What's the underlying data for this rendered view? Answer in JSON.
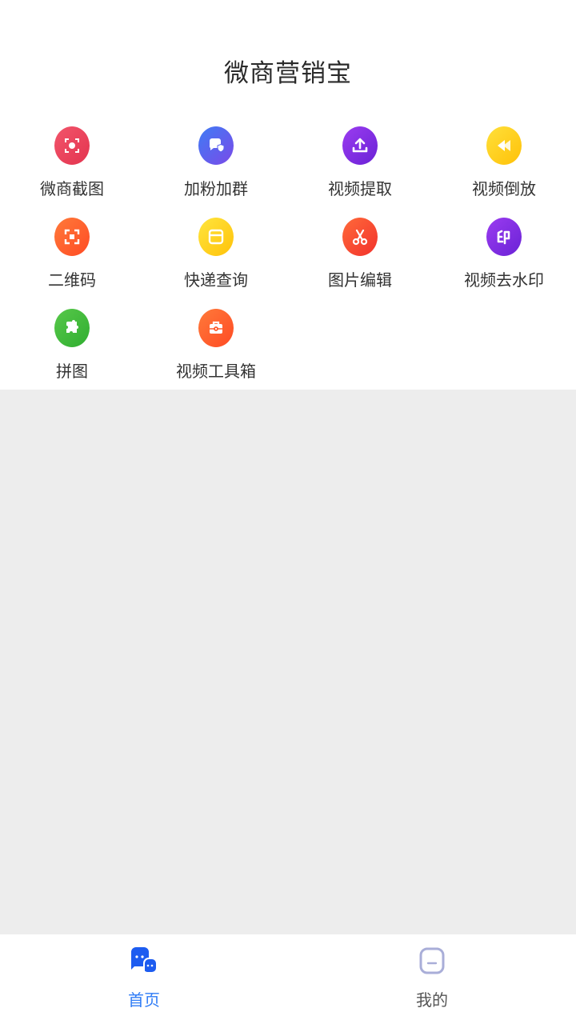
{
  "header": {
    "title": "微商营销宝"
  },
  "tools": [
    {
      "label": "微商截图",
      "icon": "screenshot-face-icon",
      "color": "#ea3c5c"
    },
    {
      "label": "加粉加群",
      "icon": "chat-shield-icon",
      "color": "#4f6bf0"
    },
    {
      "label": "视频提取",
      "icon": "upload-icon",
      "color": "#7b2fe0"
    },
    {
      "label": "视频倒放",
      "icon": "rewind-icon",
      "color": "#ffcc1a"
    },
    {
      "label": "二维码",
      "icon": "qr-scan-icon",
      "color": "#ff5a2a"
    },
    {
      "label": "快递查询",
      "icon": "package-icon",
      "color": "#ffd21a"
    },
    {
      "label": "图片编辑",
      "icon": "scissors-icon",
      "color": "#ff4d2e"
    },
    {
      "label": "视频去水印",
      "icon": "stamp-icon",
      "color": "#7a2fe0"
    },
    {
      "label": "拼图",
      "icon": "puzzle-icon",
      "color": "#3db83a"
    },
    {
      "label": "视频工具箱",
      "icon": "toolbox-icon",
      "color": "#ff5a2a"
    }
  ],
  "tabbar": {
    "home": {
      "label": "首页",
      "color": "#2f7cf6"
    },
    "mine": {
      "label": "我的",
      "color": "#555555"
    }
  }
}
